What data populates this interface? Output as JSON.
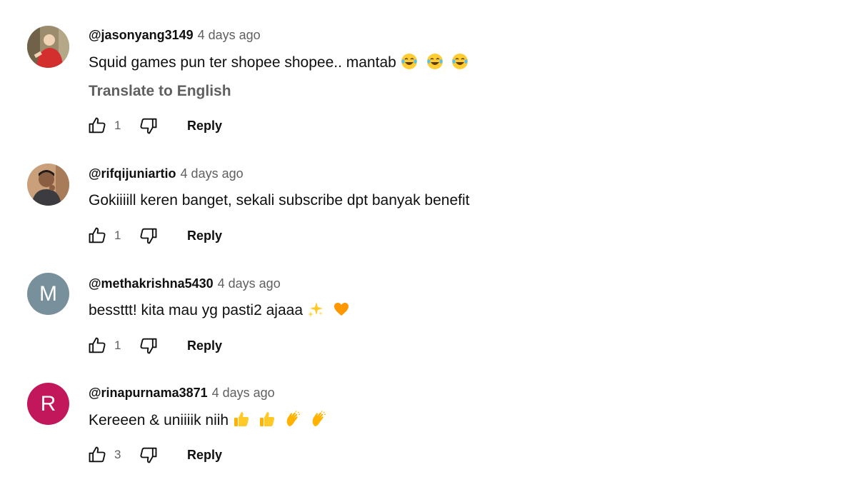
{
  "comments": [
    {
      "author": "@jasonyang3149",
      "time": "4 days ago",
      "text": "Squid games pun ter shopee shopee.. mantab",
      "emojis": [
        "joy",
        "joy",
        "joy"
      ],
      "translate": "Translate to English",
      "likes": "1",
      "reply": "Reply",
      "avatar": {
        "type": "photo",
        "colors": [
          "#8a7a5c",
          "#c8312d",
          "#f2d4b5"
        ]
      }
    },
    {
      "author": "@rifqijuniartio",
      "time": "4 days ago",
      "text": "Gokiiiill keren banget, sekali subscribe dpt banyak benefit",
      "emojis": [],
      "likes": "1",
      "reply": "Reply",
      "avatar": {
        "type": "photo",
        "colors": [
          "#b88a64",
          "#3b3b3f",
          "#7a5a44"
        ]
      }
    },
    {
      "author": "@methakrishna5430",
      "time": "4 days ago",
      "text": "bessttt! kita mau yg pasti2 ajaaa",
      "emojis": [
        "sparkles",
        "orange-heart"
      ],
      "likes": "1",
      "reply": "Reply",
      "avatar": {
        "type": "letter",
        "letter": "M",
        "color": "#78909c"
      }
    },
    {
      "author": "@rinapurnama3871",
      "time": "4 days ago",
      "text": "Kereeen & uniiiik niih",
      "emojis": [
        "thumbs-up",
        "thumbs-up",
        "clapping-hands",
        "clapping-hands"
      ],
      "likes": "3",
      "reply": "Reply",
      "avatar": {
        "type": "letter",
        "letter": "R",
        "color": "#c2185b"
      }
    }
  ]
}
